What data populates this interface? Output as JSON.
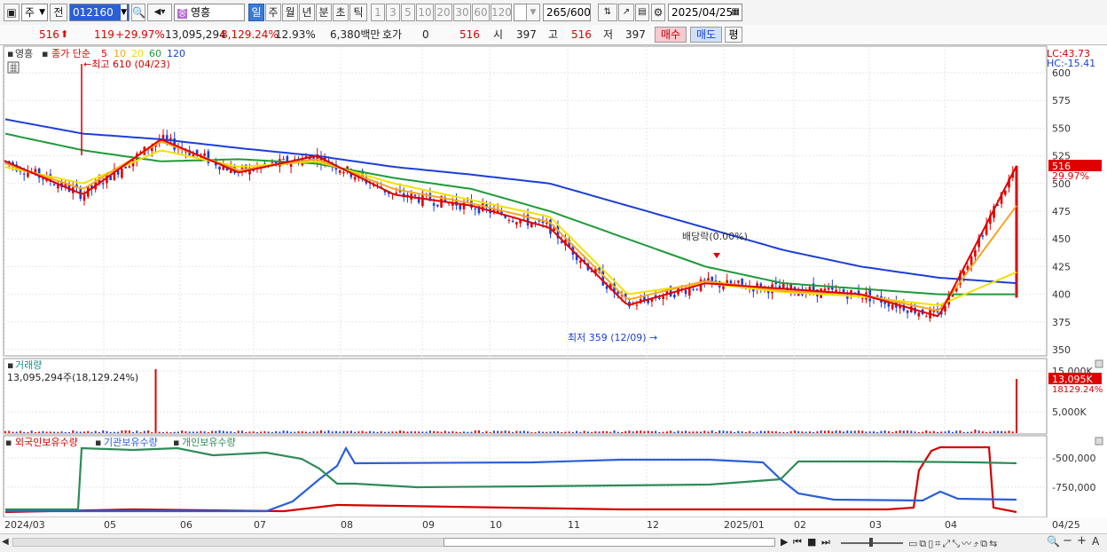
{
  "toolbar": {
    "market_type": "주",
    "prev_label": "전",
    "code": "012160",
    "stock_name": "영흥",
    "period_buttons": [
      "일",
      "주",
      "월",
      "년",
      "분",
      "초",
      "틱"
    ],
    "interval_buttons": [
      "1",
      "3",
      "5",
      "10",
      "20",
      "30",
      "60",
      "120"
    ],
    "count": "265",
    "total": "/600",
    "date": "2025/04/25"
  },
  "quote": {
    "price": "516",
    "change": "119",
    "change_rate": "+29.97%",
    "volume": "13,095,294",
    "volume_rate": "8,129.24%",
    "turnover": "12.93%",
    "amount": "6,380백만",
    "hoga_label": "호가",
    "hoga_value": "0",
    "hoga_price": "516",
    "open_label": "시",
    "open": "397",
    "high_label": "고",
    "high": "516",
    "low_label": "저",
    "low": "397",
    "buy": "매수",
    "sell": "매도",
    "avg": "평"
  },
  "price_panel": {
    "title": "영흥",
    "ma_label": "종가 단순",
    "ma_periods": [
      "5",
      "10",
      "20",
      "60",
      "120"
    ],
    "ma_colors": [
      "#e00000",
      "#f5a623",
      "#f2e000",
      "#1f9a3a",
      "#1c3fd6"
    ],
    "high_annotation": "최고 610 (04/23)",
    "low_annotation": "최저 359 (12/09)",
    "dividend_annotation": "배당락(0.00%)",
    "lc": "LC:43.73",
    "hc": "HC:-15.41",
    "current_price_tag": "516",
    "current_rate_tag": "29.97%",
    "y_ticks": [
      "600",
      "575",
      "550",
      "525",
      "500",
      "475",
      "450",
      "425",
      "400",
      "375",
      "350"
    ]
  },
  "volume_panel": {
    "title": "거래량",
    "value_label": "13,095,294주(18,129.24%)",
    "tag_value": "13,095K",
    "tag_rate": "18129.24%",
    "y_ticks": [
      "15,000K",
      "5,000K"
    ]
  },
  "holdings_panel": {
    "series_labels": [
      "외국인보유수량",
      "기관보유수량",
      "개인보유수량"
    ],
    "series_colors": [
      "#d40000",
      "#2a5fd8",
      "#2e8b57"
    ],
    "y_ticks": [
      "-500,000",
      "-750,000"
    ]
  },
  "x_axis": {
    "labels": [
      "2024/03",
      "05",
      "06",
      "07",
      "08",
      "09",
      "10",
      "11",
      "12",
      "2025/01",
      "02",
      "03",
      "04"
    ],
    "end_label": "04/25"
  },
  "chart_data": {
    "type": "line",
    "title": "영흥",
    "x": [
      "2024/03",
      "05",
      "06",
      "07",
      "08",
      "09",
      "10",
      "11",
      "12",
      "2025/01",
      "02",
      "03",
      "04",
      "04/25"
    ],
    "series": [
      {
        "name": "5",
        "values": [
          520,
          490,
          540,
          510,
          525,
          490,
          480,
          460,
          390,
          410,
          405,
          400,
          380,
          516
        ]
      },
      {
        "name": "10",
        "values": [
          518,
          495,
          538,
          512,
          522,
          495,
          482,
          465,
          395,
          412,
          403,
          400,
          385,
          480
        ]
      },
      {
        "name": "20",
        "values": [
          515,
          500,
          530,
          515,
          520,
          500,
          485,
          470,
          400,
          410,
          402,
          398,
          390,
          420
        ]
      },
      {
        "name": "60",
        "values": [
          545,
          530,
          520,
          522,
          518,
          505,
          495,
          475,
          450,
          425,
          410,
          405,
          400,
          400
        ]
      },
      {
        "name": "120",
        "values": [
          558,
          545,
          540,
          532,
          525,
          515,
          508,
          500,
          480,
          460,
          440,
          425,
          415,
          410
        ]
      }
    ],
    "ylim": [
      350,
      610
    ],
    "high": 610,
    "low": 359,
    "last": 516
  }
}
